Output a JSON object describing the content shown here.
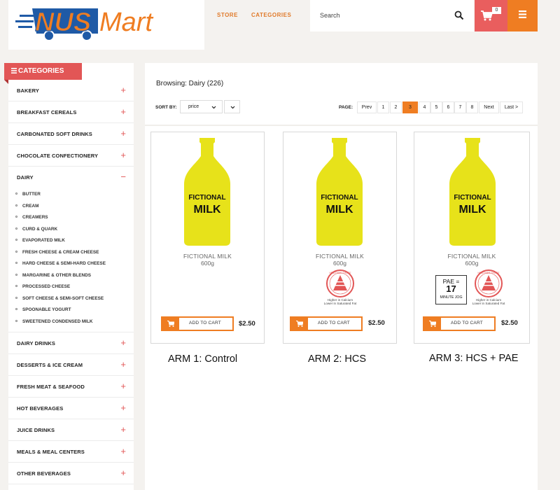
{
  "header": {
    "logo_text": "NUS Mart",
    "nav": [
      "STORE",
      "CATEGORIES"
    ],
    "search_placeholder": "Search",
    "cart_count": "0",
    "colors": {
      "accent_orange": "#ef7d22",
      "accent_red": "#e95e5e",
      "logo_blue": "#1f5aa6"
    }
  },
  "sidebar": {
    "title": "CATEGORIES",
    "categories_top": [
      {
        "label": "BAKERY",
        "toggle": "+"
      },
      {
        "label": "BREAKFAST CEREALS",
        "toggle": "+"
      },
      {
        "label": "CARBONATED SOFT DRINKS",
        "toggle": "+"
      },
      {
        "label": "CHOCOLATE CONFECTIONERY",
        "toggle": "+"
      }
    ],
    "dairy": {
      "label": "DAIRY",
      "toggle": "−",
      "subitems": [
        "BUTTER",
        "CREAM",
        "CREAMERS",
        "CURD & QUARK",
        "EVAPORATED MILK",
        "FRESH CHEESE & CREAM CHEESE",
        "HARD CHEESE & SEMI-HARD CHEESE",
        "MARGARINE & OTHER BLENDS",
        "PROCESSED CHEESE",
        "SOFT CHEESE & SEMI-SOFT CHEESE",
        "SPOONABLE YOGURT",
        "SWEETENED CONDENSED MILK"
      ]
    },
    "categories_bottom": [
      {
        "label": "DAIRY DRINKS",
        "toggle": "+"
      },
      {
        "label": "DESSERTS & ICE CREAM",
        "toggle": "+"
      },
      {
        "label": "FRESH MEAT & SEAFOOD",
        "toggle": "+"
      },
      {
        "label": "HOT BEVERAGES",
        "toggle": "+"
      },
      {
        "label": "JUICE DRINKS",
        "toggle": "+"
      },
      {
        "label": "MEALS & MEAL CENTERS",
        "toggle": "+"
      },
      {
        "label": "OTHER BEVERAGES",
        "toggle": "+"
      }
    ]
  },
  "toolbar": {
    "browsing": "Browsing: Dairy (226)",
    "sort_label": "SORT BY:",
    "sort_value": "price",
    "page_label": "PAGE:",
    "pages": [
      "Prev",
      "1",
      "2",
      "3",
      "4",
      "5",
      "6",
      "7",
      "8",
      "Next",
      "Last >"
    ],
    "current_page": "3"
  },
  "products": [
    {
      "bottle_line1": "FICTIONAL",
      "bottle_line2": "MILK",
      "name": "FICTIONAL MILK",
      "size": "600g",
      "add_label": "ADD TO CART",
      "price": "$2.50",
      "arm": "ARM 1: Control"
    },
    {
      "bottle_line1": "FICTIONAL",
      "bottle_line2": "MILK",
      "name": "FICTIONAL MILK",
      "size": "600g",
      "add_label": "ADD TO CART",
      "price": "$2.50",
      "arm": "ARM 2: HCS",
      "hcs": {
        "ring_text": "HEALTHIER CHOICE",
        "line1": "Higher in Calcium",
        "line2": "Lower in Saturated Fat"
      }
    },
    {
      "bottle_line1": "FICTIONAL",
      "bottle_line2": "MILK",
      "name": "FICTIONAL MILK",
      "size": "600g",
      "add_label": "ADD TO CART",
      "price": "$2.50",
      "arm": "ARM 3: HCS + PAE",
      "hcs": {
        "ring_text": "HEALTHIER CHOICE",
        "line1": "Higher in Calcium",
        "line2": "Lower in Saturated Fat"
      },
      "pae": {
        "line1": "PAE =",
        "value": "17",
        "line2": "MINUTE JOG"
      }
    }
  ]
}
